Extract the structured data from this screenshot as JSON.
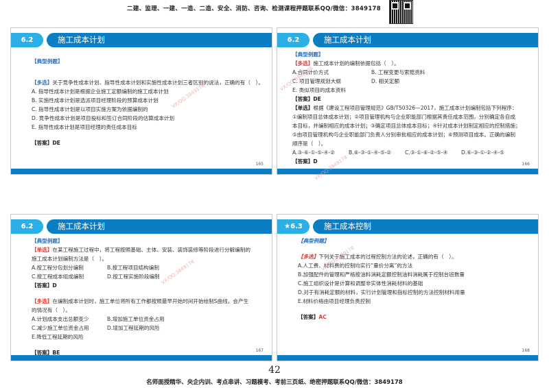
{
  "top_banner": "二建、监理、一建、一造、二造、安全、消防、咨询、检测课程押题联系QQ/微信：3849178",
  "bottom_banner": "名师面授精华、央企内训、考点串讲、习题模考、考前三页纸、绝密押题联系QQ/微信：3849178",
  "page_number": "42",
  "watermark": "VX/QQ:3849178",
  "colors": {
    "section_num": "#2ab0e4",
    "section_bar": "#0b7dc2",
    "tag_red": "#e53935",
    "section_title_blue": "#2e6fb5"
  },
  "slides": [
    {
      "section": "6.2",
      "title": "施工成本计划",
      "page": "165",
      "lines": [
        {
          "type": "sectitle",
          "text": "【典型例题】",
          "gap": 1
        },
        {
          "type": "q",
          "tag": "【多选】",
          "tag_color": "#2e6fb5",
          "text": "关于竞争性成本计划、指导性成本计划和实施性成本计划三者区别的说法，正确的有（　）。",
          "gap": 2
        },
        {
          "type": "text",
          "text": "A. 指导性成本计划是根据企业施工定额编制的施工成本计划"
        },
        {
          "type": "text",
          "text": "B. 实施性成本计划是选派项目经理阶段的预算成本计划"
        },
        {
          "type": "text",
          "text": "C. 指导性成本计划是以项目实施方案为依据编制的"
        },
        {
          "type": "text",
          "text": "D. 竞争性成本计划是项目投标和签订合同阶段的估算成本计划"
        },
        {
          "type": "text",
          "text": "E. 指导性成本计划是项目经理的责任成本目标"
        },
        {
          "type": "ans",
          "label": "【答案】",
          "value": "DE",
          "value_color": "#222222",
          "gap": 1
        }
      ]
    },
    {
      "section": "6.2",
      "title": "施工成本计划",
      "page": "166",
      "lines": [
        {
          "type": "sectitle",
          "text": "【典型例题】"
        },
        {
          "type": "q",
          "tag": "【多选】",
          "tag_color": "#e53935",
          "text": "施工成本计划的编制依据包括（　）。"
        },
        {
          "type": "opt2",
          "opts": [
            "A.合同计价方式",
            "B. 工程变更与索赔资料"
          ]
        },
        {
          "type": "opt2",
          "opts": [
            "C. 项目管理规划大纲",
            "D. 相关定额"
          ]
        },
        {
          "type": "text",
          "text": "E. 类似项目的成本资料"
        },
        {
          "type": "ans",
          "label": "【答案】",
          "value": "DE",
          "value_color": "#222222"
        },
        {
          "type": "q",
          "tag": "【单选】",
          "tag_color": "#222222",
          "text": "根据《建设工程项目管理规范》GB/T50326—2017，施工成本计划编制包括下列程序："
        },
        {
          "type": "text",
          "text": "①编制项目总体成本计划；②项目管理机构与企业职能部门根据其责任成本范围，分别确定各自成"
        },
        {
          "type": "text",
          "text": "本目标，并编制相应的成本计划；③确定项目总体成本目标；④针对成本计划制定相应的控制措施；"
        },
        {
          "type": "text",
          "text": "⑤由项目管理机构与企业职能部门负责人分别审批相应的成本计划；⑥预测项目成本。正确的编制"
        },
        {
          "type": "text",
          "text": "顺序是（　）。"
        },
        {
          "type": "opt4",
          "opts": [
            "A.③-⑥-①-⑤-④-②",
            "B.⑥-③-①-④-⑤-②",
            "C.③-①-⑥-②-⑤-④",
            "D.⑥-③-①-②-④-⑤"
          ]
        },
        {
          "type": "ans",
          "label": "【答案】",
          "value": "D",
          "value_color": "#222222"
        }
      ]
    },
    {
      "section": "6.2",
      "title": "施工成本计划",
      "page": "167",
      "lines": [
        {
          "type": "sectitle",
          "text": "【典型例题】"
        },
        {
          "type": "q",
          "tag": "【单选】",
          "tag_color": "#e53935",
          "text": "在某工程施工过程中，将工程按照基础、主体、安装、装饰装修等阶段进行分解编制的"
        },
        {
          "type": "text",
          "text": "施工成本计划编制方法是（　）。"
        },
        {
          "type": "opt2",
          "opts": [
            "A.按工程分包划分编制",
            "B.按工程项目结构编制"
          ]
        },
        {
          "type": "opt2",
          "opts": [
            "C.按工程成本组成编制",
            "D.按工程实施阶段编制"
          ]
        },
        {
          "type": "ans",
          "label": "【答案】",
          "value": "D",
          "value_color": "#222222"
        },
        {
          "type": "q",
          "tag": "【多选】",
          "tag_color": "#e53935",
          "text": "在编制成本计划时，施工单位将所有工作都按照最早开始时间开始绘制S曲线，会产生",
          "gap": 1
        },
        {
          "type": "text",
          "text": "的情况有（　）。"
        },
        {
          "type": "opt2",
          "opts": [
            "A.计划成本支出总额变少",
            "B.增加施工单位资金占用"
          ]
        },
        {
          "type": "opt2",
          "opts": [
            "C.减少施工单位资金占用",
            "D.增加工程延期的风险"
          ]
        },
        {
          "type": "text",
          "text": "E.降低工程延期的风险"
        },
        {
          "type": "ans",
          "label": "【答案】",
          "value": "BE",
          "value_color": "#222222",
          "gap": 1
        }
      ]
    },
    {
      "section": "★6.3",
      "title": "施工成本控制",
      "page": "168",
      "lines": [
        {
          "type": "sectitle",
          "text": "【典型例题】"
        },
        {
          "type": "q",
          "tag": "【多选】",
          "tag_color": "#e53935",
          "text": "下列关于施工成本的过程控制方法的论述，正确的有（　）。",
          "gap": 1
        },
        {
          "type": "text",
          "text": "A.人工费、材料费的控制均实行“量价分离”的方法"
        },
        {
          "type": "text",
          "text": "B.加强配件的管理和严格按油料消耗定额控制油料消耗属于控制台班数量"
        },
        {
          "type": "text",
          "text": "C.施工组织设计是计算和调整非实体性消耗材料的基础"
        },
        {
          "type": "text",
          "text": "D.对于有消耗定额的材料，实行计划管理和指标控制的方法控制材料用量"
        },
        {
          "type": "text",
          "text": "E.材料价格由项目经理负责控制"
        },
        {
          "type": "ans",
          "label": "【答案】",
          "value": "AC",
          "value_color": "#e53935",
          "gap": 1
        }
      ]
    }
  ]
}
